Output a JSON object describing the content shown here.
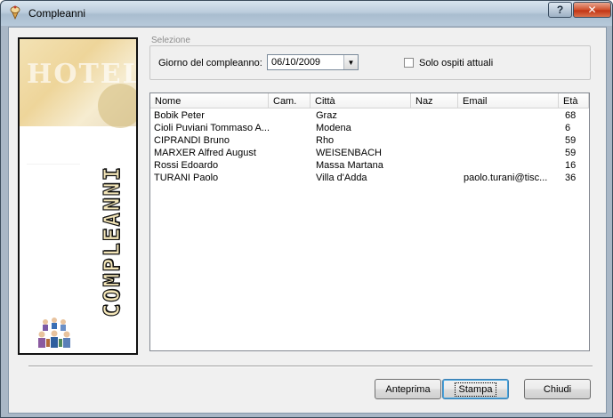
{
  "window": {
    "title": "Compleanni"
  },
  "titlebar": {
    "help_label": "?",
    "close_label": "✕"
  },
  "banner": {
    "hotel_text": "HOTEL",
    "vertical_text": "COMPLEANNI"
  },
  "selection": {
    "group_label": "Selezione",
    "date_label": "Giorno del compleanno:",
    "date_value": "06/10/2009",
    "checkbox_label": "Solo ospiti attuali",
    "checkbox_checked": false
  },
  "list": {
    "columns": [
      "Nome",
      "Cam.",
      "Città",
      "Naz",
      "Email",
      "Età"
    ],
    "rows": [
      {
        "nome": "Bobik Peter",
        "cam": "",
        "citta": "Graz",
        "naz": "",
        "email": "",
        "eta": "68"
      },
      {
        "nome": "Cioli Puviani Tommaso A...",
        "cam": "",
        "citta": "Modena",
        "naz": "",
        "email": "",
        "eta": "6"
      },
      {
        "nome": "CIPRANDI Bruno",
        "cam": "",
        "citta": "Rho",
        "naz": "",
        "email": "",
        "eta": "59"
      },
      {
        "nome": "MARXER Alfred August",
        "cam": "",
        "citta": "WEISENBACH",
        "naz": "",
        "email": "",
        "eta": "59"
      },
      {
        "nome": "Rossi Edoardo",
        "cam": "",
        "citta": "Massa Martana",
        "naz": "",
        "email": "",
        "eta": "16"
      },
      {
        "nome": "TURANI Paolo",
        "cam": "",
        "citta": "Villa d'Adda",
        "naz": "",
        "email": "paolo.turani@tisc...",
        "eta": "36"
      }
    ]
  },
  "buttons": {
    "preview": "Anteprima",
    "print": "Stampa",
    "close": "Chiudi"
  },
  "colors": {
    "title_gradient_top": "#d8e4ef",
    "close_red": "#c23414",
    "client_bg": "#f0f0f0",
    "default_button_border": "#3c7fb1"
  }
}
